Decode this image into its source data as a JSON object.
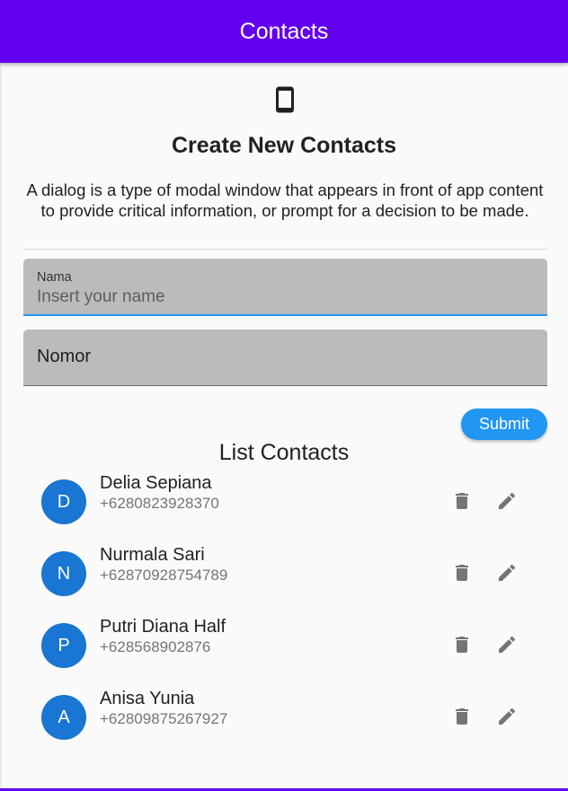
{
  "appbar": {
    "title": "Contacts",
    "color": "#6200ee"
  },
  "form": {
    "icon": "smartphone-icon",
    "heading": "Create New Contacts",
    "description": "A dialog is a type of modal window that appears in front of app content to provide critical information, or prompt for a decision to be made.",
    "name_field": {
      "label": "Nama",
      "value": "",
      "placeholder": "Insert your name"
    },
    "number_field": {
      "label": "Nomor",
      "value": ""
    },
    "submit_label": "Submit"
  },
  "list": {
    "title": "List Contacts",
    "contacts": [
      {
        "initial": "D",
        "name": "Delia Sepiana",
        "phone": "+6280823928370"
      },
      {
        "initial": "N",
        "name": "Nurmala Sari",
        "phone": "+62870928754789"
      },
      {
        "initial": "P",
        "name": "Putri Diana Half",
        "phone": "+628568902876"
      },
      {
        "initial": "A",
        "name": "Anisa Yunia",
        "phone": "+62809875267927"
      }
    ]
  },
  "colors": {
    "accent": "#2196f3",
    "avatar": "#1976d2",
    "field_bg": "#bbbbbb",
    "icon": "#757575"
  }
}
